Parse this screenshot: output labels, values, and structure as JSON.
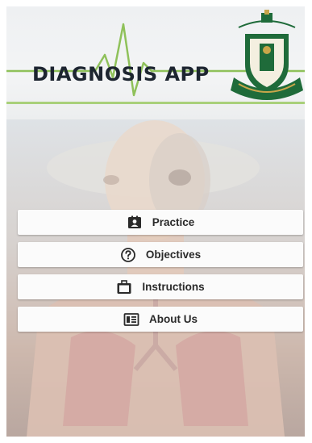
{
  "app": {
    "title": "DIAGNOSIS APP"
  },
  "menu": {
    "items": [
      {
        "label": "Practice",
        "icon": "contact-card-icon"
      },
      {
        "label": "Objectives",
        "icon": "help-circle-icon"
      },
      {
        "label": "Instructions",
        "icon": "briefcase-icon"
      },
      {
        "label": "About Us",
        "icon": "info-list-icon"
      }
    ]
  },
  "colors": {
    "title": "#1d2530",
    "accent_green": "#8fc15a",
    "logo_green": "#1f6b3a",
    "logo_gold": "#c8a64a",
    "button_bg": "#fbfbfb",
    "button_text": "#2a2a2a"
  }
}
